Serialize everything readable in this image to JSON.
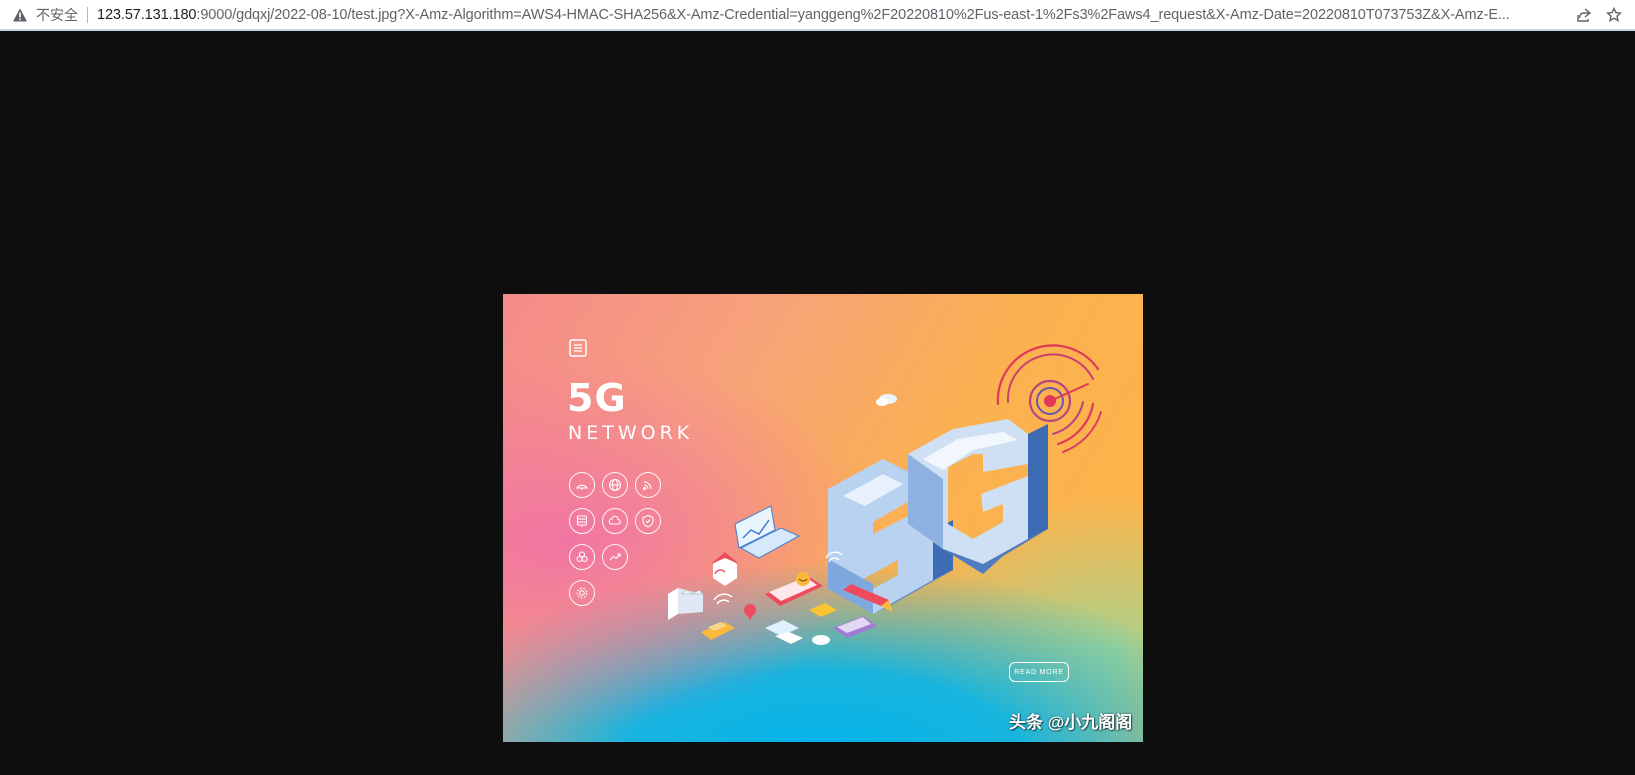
{
  "addressbar": {
    "security_label": "不安全",
    "url_host": "123.57.131.180",
    "url_rest": ":9000/gdqxj/2022-08-10/test.jpg?X-Amz-Algorithm=AWS4-HMAC-SHA256&X-Amz-Credential=yanggeng%2F20220810%2Fus-east-1%2Fs3%2Faws4_request&X-Amz-Date=20220810T073753Z&X-Amz-E..."
  },
  "image": {
    "title": "5G",
    "subtitle": "NETWORK",
    "button_label": "READ MORE",
    "watermark": "头条 @小九阁阁"
  },
  "colors": {
    "page_background": "#0e0e0e",
    "accent_red": "#e0375a",
    "cube_blue": "#6f9fd8"
  }
}
